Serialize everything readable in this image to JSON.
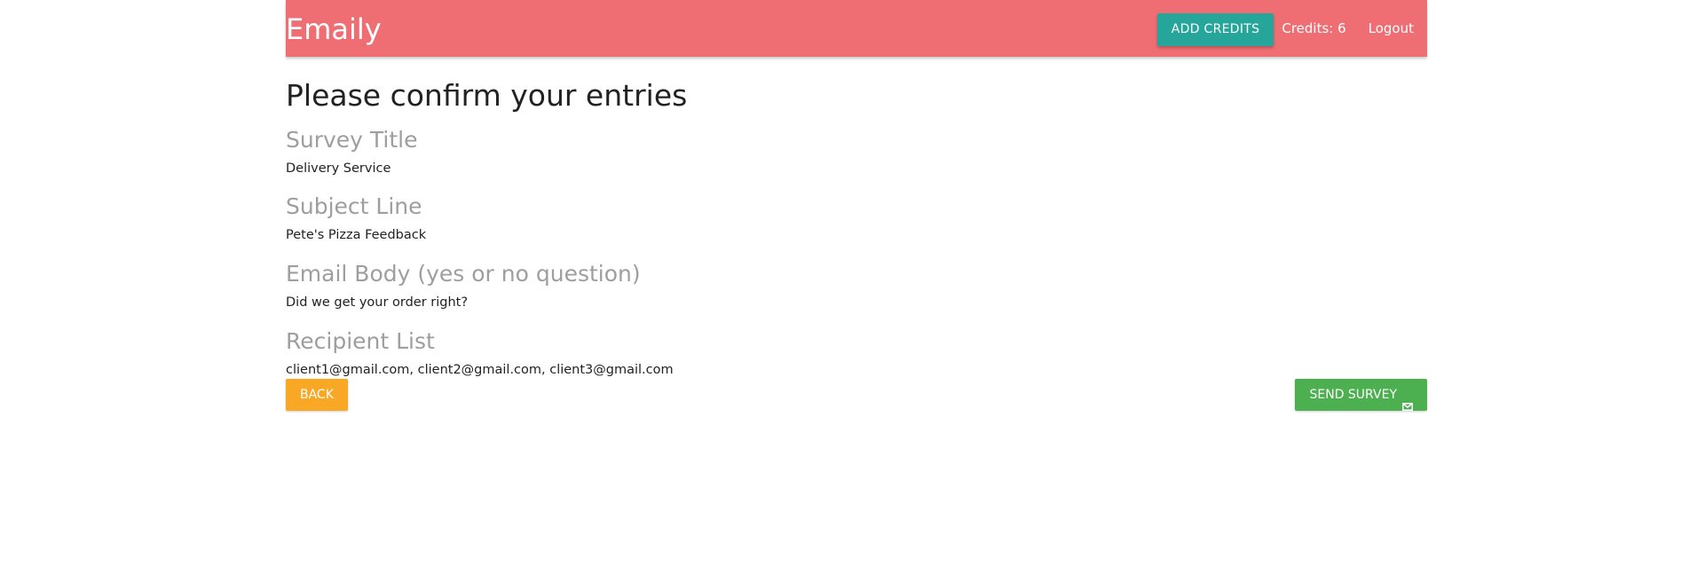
{
  "app": {
    "brand": "Emaily"
  },
  "header": {
    "add_credits_label": "ADD CREDITS",
    "credits_text": "Credits: 6",
    "logout_label": "Logout"
  },
  "main": {
    "title": "Please confirm your entries",
    "fields": [
      {
        "label": "Survey Title",
        "value": "Delivery Service"
      },
      {
        "label": "Subject Line",
        "value": "Pete's Pizza Feedback"
      },
      {
        "label": "Email Body (yes or no question)",
        "value": "Did we get your order right?"
      },
      {
        "label": "Recipient List",
        "value": "client1@gmail.com, client2@gmail.com, client3@gmail.com"
      }
    ],
    "back_label": "BACK",
    "send_label": "SEND SURVEY"
  },
  "icons": {
    "send": "mail-icon"
  },
  "colors": {
    "navbar": "#ef6e73",
    "add_credits": "#26a69a",
    "back": "#f9a825",
    "send": "#4caf50",
    "label_grey": "#9e9e9e"
  }
}
